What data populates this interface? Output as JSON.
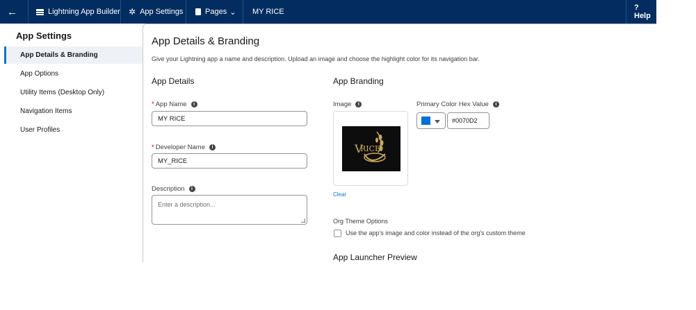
{
  "topbar": {
    "back_icon": "←",
    "builder_label": "Lightning App Builder",
    "settings_label": "App Settings",
    "pages_label": "Pages",
    "pages_caret": "⌄",
    "app_name": "MY RICE",
    "help_label": "? Help"
  },
  "sidebar": {
    "title": "App Settings",
    "items": [
      {
        "label": "App Details & Branding"
      },
      {
        "label": "App Options"
      },
      {
        "label": "Utility Items (Desktop Only)"
      },
      {
        "label": "Navigation Items"
      },
      {
        "label": "User Profiles"
      }
    ]
  },
  "panel": {
    "title": "App Details & Branding",
    "description": "Give your Lightning app a name and description. Upload an image and choose the highlight color for its navigation bar.",
    "details": {
      "title": "App Details",
      "app_name_label": "App Name",
      "app_name_value": "MY RICE",
      "dev_name_label": "Developer Name",
      "dev_name_value": "MY_RICE",
      "description_label": "Description",
      "description_placeholder": "Enter a description..."
    },
    "branding": {
      "title": "App Branding",
      "image_label": "Image",
      "clear_label": "Clear",
      "color_label": "Primary Color Hex Value",
      "color_value": "#0070D2",
      "theme_label": "Org Theme Options",
      "theme_checkbox_label": "Use the app's image and color instead of the org's custom theme",
      "launcher_title": "App Launcher Preview"
    }
  },
  "colors": {
    "topbar": "#032d60",
    "accent": "#0070d2",
    "logo_gold": "#c9a85a"
  }
}
